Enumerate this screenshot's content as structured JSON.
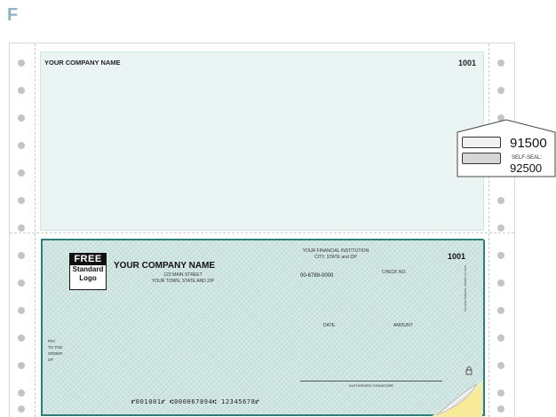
{
  "corner_letter": "F",
  "stub": {
    "company_name": "YOUR COMPANY NAME",
    "check_number": "1001"
  },
  "check": {
    "logo": {
      "line1": "FREE",
      "line2": "Standard",
      "line3": "Logo"
    },
    "company_name": "YOUR COMPANY NAME",
    "company_street": "123 MAIN STREET",
    "company_city": "YOUR TOWN, STATE AND ZIP",
    "bank_name": "YOUR FINANCIAL INSTITUTION",
    "bank_city": "CITY, STATE and ZIP",
    "routing_fraction": "00-6789-0000",
    "check_no_label": "CHECK NO.",
    "check_number": "1001",
    "date_label": "DATE",
    "amount_label": "AMOUNT",
    "pay_to": [
      "PAY",
      "TO THE",
      "ORDER",
      "OF"
    ],
    "signature_label": "AUTHORIZED SIGNATURE",
    "micr_line": "⑈001001⑈ ⑆000067894⑆ 12345678⑈",
    "security_text": "Security features. Details on back."
  },
  "seal_insert": {
    "number_top": "91500",
    "label": "SELF-SEAL:",
    "number_bottom": "92500"
  },
  "colors": {
    "check_background": "#cfe5e2",
    "check_border": "#2a7f76",
    "stub_background": "#eaf4f3"
  }
}
